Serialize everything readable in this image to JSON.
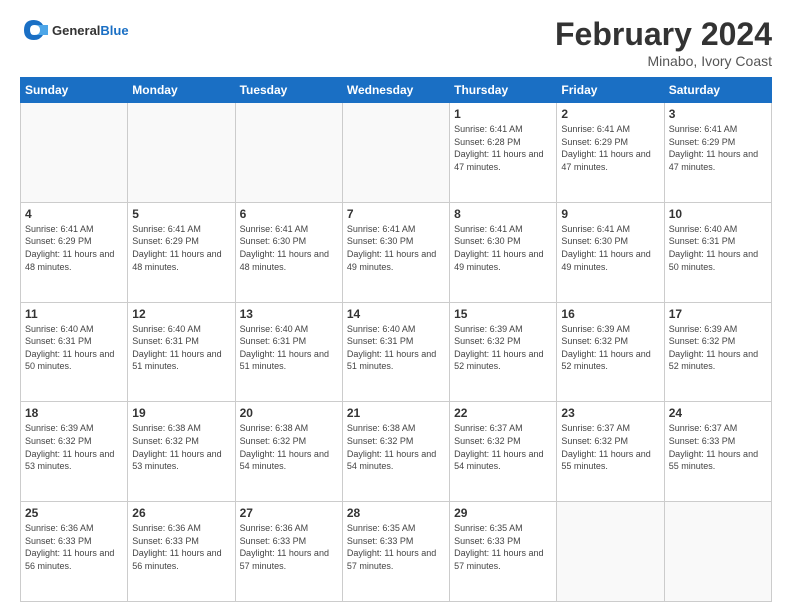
{
  "logo": {
    "text_general": "General",
    "text_blue": "Blue"
  },
  "title": "February 2024",
  "subtitle": "Minabo, Ivory Coast",
  "days_of_week": [
    "Sunday",
    "Monday",
    "Tuesday",
    "Wednesday",
    "Thursday",
    "Friday",
    "Saturday"
  ],
  "weeks": [
    [
      {
        "num": "",
        "info": ""
      },
      {
        "num": "",
        "info": ""
      },
      {
        "num": "",
        "info": ""
      },
      {
        "num": "",
        "info": ""
      },
      {
        "num": "1",
        "info": "Sunrise: 6:41 AM\nSunset: 6:28 PM\nDaylight: 11 hours\nand 47 minutes."
      },
      {
        "num": "2",
        "info": "Sunrise: 6:41 AM\nSunset: 6:29 PM\nDaylight: 11 hours\nand 47 minutes."
      },
      {
        "num": "3",
        "info": "Sunrise: 6:41 AM\nSunset: 6:29 PM\nDaylight: 11 hours\nand 47 minutes."
      }
    ],
    [
      {
        "num": "4",
        "info": "Sunrise: 6:41 AM\nSunset: 6:29 PM\nDaylight: 11 hours\nand 48 minutes."
      },
      {
        "num": "5",
        "info": "Sunrise: 6:41 AM\nSunset: 6:29 PM\nDaylight: 11 hours\nand 48 minutes."
      },
      {
        "num": "6",
        "info": "Sunrise: 6:41 AM\nSunset: 6:30 PM\nDaylight: 11 hours\nand 48 minutes."
      },
      {
        "num": "7",
        "info": "Sunrise: 6:41 AM\nSunset: 6:30 PM\nDaylight: 11 hours\nand 49 minutes."
      },
      {
        "num": "8",
        "info": "Sunrise: 6:41 AM\nSunset: 6:30 PM\nDaylight: 11 hours\nand 49 minutes."
      },
      {
        "num": "9",
        "info": "Sunrise: 6:41 AM\nSunset: 6:30 PM\nDaylight: 11 hours\nand 49 minutes."
      },
      {
        "num": "10",
        "info": "Sunrise: 6:40 AM\nSunset: 6:31 PM\nDaylight: 11 hours\nand 50 minutes."
      }
    ],
    [
      {
        "num": "11",
        "info": "Sunrise: 6:40 AM\nSunset: 6:31 PM\nDaylight: 11 hours\nand 50 minutes."
      },
      {
        "num": "12",
        "info": "Sunrise: 6:40 AM\nSunset: 6:31 PM\nDaylight: 11 hours\nand 51 minutes."
      },
      {
        "num": "13",
        "info": "Sunrise: 6:40 AM\nSunset: 6:31 PM\nDaylight: 11 hours\nand 51 minutes."
      },
      {
        "num": "14",
        "info": "Sunrise: 6:40 AM\nSunset: 6:31 PM\nDaylight: 11 hours\nand 51 minutes."
      },
      {
        "num": "15",
        "info": "Sunrise: 6:39 AM\nSunset: 6:32 PM\nDaylight: 11 hours\nand 52 minutes."
      },
      {
        "num": "16",
        "info": "Sunrise: 6:39 AM\nSunset: 6:32 PM\nDaylight: 11 hours\nand 52 minutes."
      },
      {
        "num": "17",
        "info": "Sunrise: 6:39 AM\nSunset: 6:32 PM\nDaylight: 11 hours\nand 52 minutes."
      }
    ],
    [
      {
        "num": "18",
        "info": "Sunrise: 6:39 AM\nSunset: 6:32 PM\nDaylight: 11 hours\nand 53 minutes."
      },
      {
        "num": "19",
        "info": "Sunrise: 6:38 AM\nSunset: 6:32 PM\nDaylight: 11 hours\nand 53 minutes."
      },
      {
        "num": "20",
        "info": "Sunrise: 6:38 AM\nSunset: 6:32 PM\nDaylight: 11 hours\nand 54 minutes."
      },
      {
        "num": "21",
        "info": "Sunrise: 6:38 AM\nSunset: 6:32 PM\nDaylight: 11 hours\nand 54 minutes."
      },
      {
        "num": "22",
        "info": "Sunrise: 6:37 AM\nSunset: 6:32 PM\nDaylight: 11 hours\nand 54 minutes."
      },
      {
        "num": "23",
        "info": "Sunrise: 6:37 AM\nSunset: 6:32 PM\nDaylight: 11 hours\nand 55 minutes."
      },
      {
        "num": "24",
        "info": "Sunrise: 6:37 AM\nSunset: 6:33 PM\nDaylight: 11 hours\nand 55 minutes."
      }
    ],
    [
      {
        "num": "25",
        "info": "Sunrise: 6:36 AM\nSunset: 6:33 PM\nDaylight: 11 hours\nand 56 minutes."
      },
      {
        "num": "26",
        "info": "Sunrise: 6:36 AM\nSunset: 6:33 PM\nDaylight: 11 hours\nand 56 minutes."
      },
      {
        "num": "27",
        "info": "Sunrise: 6:36 AM\nSunset: 6:33 PM\nDaylight: 11 hours\nand 57 minutes."
      },
      {
        "num": "28",
        "info": "Sunrise: 6:35 AM\nSunset: 6:33 PM\nDaylight: 11 hours\nand 57 minutes."
      },
      {
        "num": "29",
        "info": "Sunrise: 6:35 AM\nSunset: 6:33 PM\nDaylight: 11 hours\nand 57 minutes."
      },
      {
        "num": "",
        "info": ""
      },
      {
        "num": "",
        "info": ""
      }
    ]
  ]
}
